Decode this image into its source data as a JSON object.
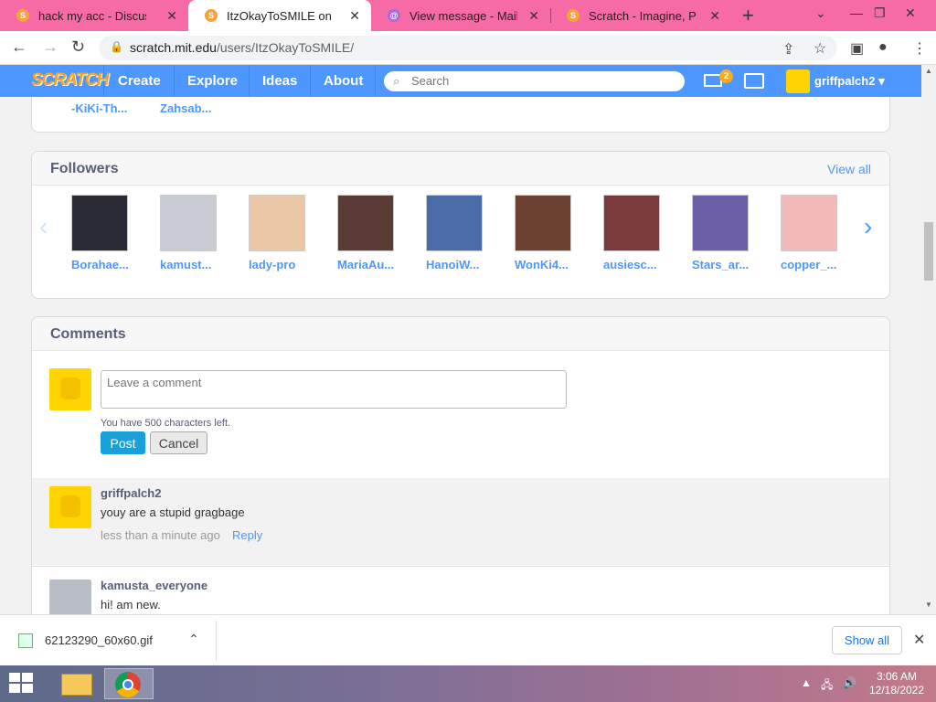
{
  "browser": {
    "tabs": [
      {
        "title": "hack my acc - Discuss Sc",
        "icon": "scratch-favicon"
      },
      {
        "title": "ItzOkayToSMILE on Scrat",
        "icon": "scratch-favicon",
        "active": true
      },
      {
        "title": "View message - Mail.tm",
        "icon": "mail-favicon"
      },
      {
        "title": "Scratch - Imagine, Progr",
        "icon": "scratch-favicon"
      }
    ],
    "url_host": "scratch.mit.edu",
    "url_path": "/users/ItzOkayToSMILE/"
  },
  "navbar": {
    "logo": "SCRATCH",
    "links": [
      "Create",
      "Explore",
      "Ideas",
      "About"
    ],
    "search_placeholder": "Search",
    "messages_count": "2",
    "username": "griffpalch2"
  },
  "top_partial": {
    "names": [
      "-KiKi-Th...",
      "Zahsab..."
    ]
  },
  "followers": {
    "title": "Followers",
    "view_all": "View all",
    "items": [
      {
        "name": "Borahae...",
        "color": "#2b2b35"
      },
      {
        "name": "kamust...",
        "color": "#c8ccd2"
      },
      {
        "name": "lady-pro",
        "color": "#e9c6a6"
      },
      {
        "name": "MariaAu...",
        "color": "#5a3b36"
      },
      {
        "name": "HanoiW...",
        "color": "#4a6aa8"
      },
      {
        "name": "WonKi4...",
        "color": "#6b4232"
      },
      {
        "name": "ausiesc...",
        "color": "#7a3a3e"
      },
      {
        "name": "Stars_ar...",
        "color": "#6c5fa8"
      },
      {
        "name": "copper_...",
        "color": "#f2b9b9"
      }
    ]
  },
  "comments": {
    "title": "Comments",
    "input_placeholder": "Leave a comment",
    "chars_left": "You have 500 characters left.",
    "post_label": "Post",
    "cancel_label": "Cancel",
    "list": [
      {
        "user": "griffpalch2",
        "text": "youy are a stupid gragbage",
        "time": "less than a minute ago",
        "reply": "Reply"
      },
      {
        "user": "kamusta_everyone",
        "text": "hi! am new.",
        "time": "",
        "reply": ""
      }
    ]
  },
  "download_bar": {
    "file_name": "62123290_60x60.gif",
    "show_all": "Show all"
  },
  "taskbar": {
    "time": "3:06 AM",
    "date": "12/18/2022"
  }
}
